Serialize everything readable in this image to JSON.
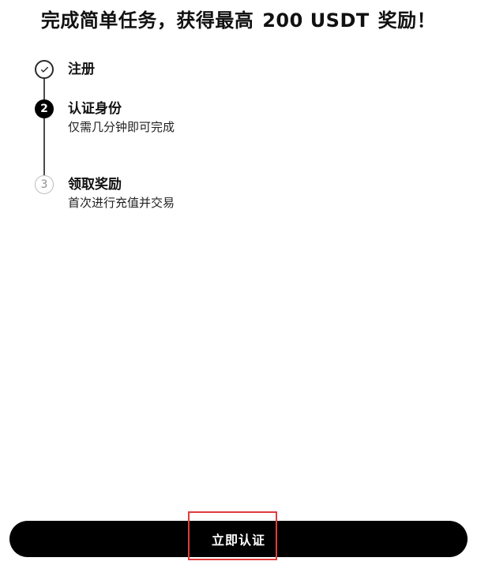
{
  "header": {
    "prefix": "完成简单任务，获得最高",
    "amount": "200 USDT",
    "suffix": "奖励！",
    "accent_color": "#b6f23c"
  },
  "steps": [
    {
      "title": "注册",
      "subtitle": "",
      "status": "completed",
      "icon": "check-icon"
    },
    {
      "title": "认证身份",
      "subtitle": "仅需几分钟即可完成",
      "status": "current",
      "number": "2"
    },
    {
      "title": "领取奖励",
      "subtitle": "首次进行充值并交易",
      "status": "pending",
      "number": "3"
    }
  ],
  "cta": {
    "label": "立即认证",
    "background": "#000000",
    "focus_color": "#e33b3b"
  }
}
